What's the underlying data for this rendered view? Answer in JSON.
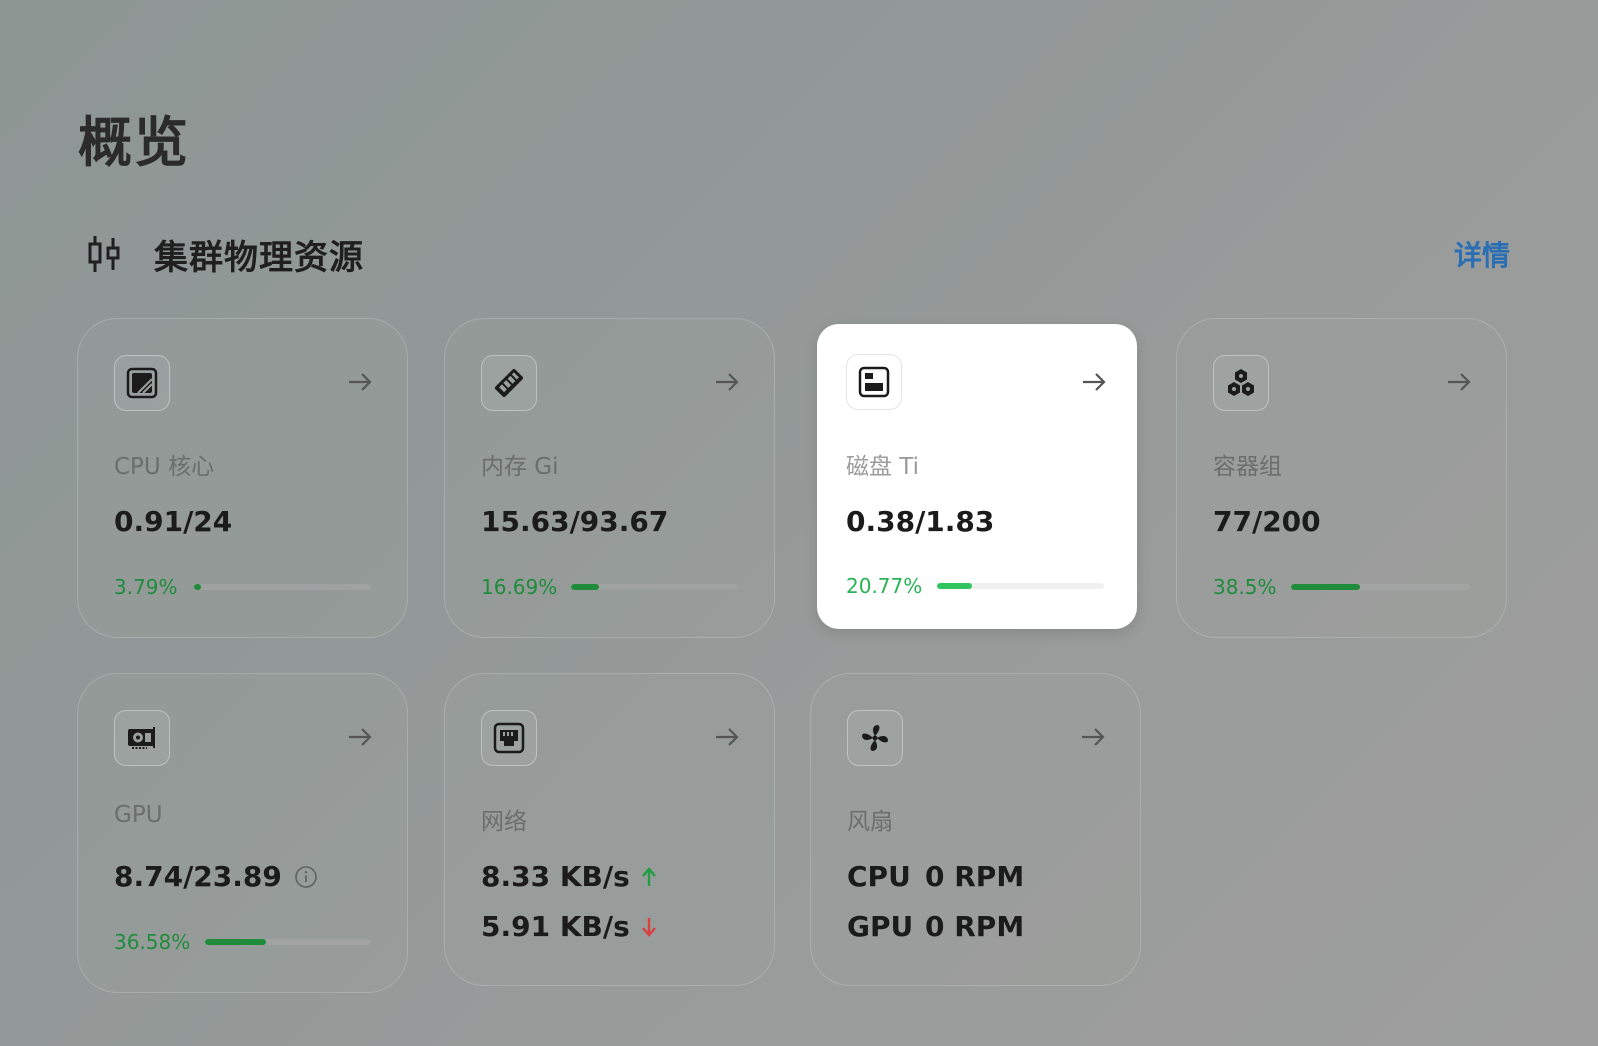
{
  "page": {
    "title": "概览"
  },
  "section": {
    "title": "集群物理资源",
    "details_label": "详情",
    "details_color": "#2a6fb3"
  },
  "cards": {
    "cpu": {
      "label": "CPU 核心",
      "value": "0.91/24",
      "percent": "3.79%",
      "progress": 0.0379,
      "icon": "cpu-chip-icon"
    },
    "memory": {
      "label": "内存 Gi",
      "value": "15.63/93.67",
      "percent": "16.69%",
      "progress": 0.1669,
      "icon": "memory-stick-icon"
    },
    "disk": {
      "label": "磁盘 Ti",
      "value": "0.38/1.83",
      "percent": "20.77%",
      "progress": 0.2077,
      "icon": "disk-drive-icon",
      "active": true
    },
    "pods": {
      "label": "容器组",
      "value": "77/200",
      "percent": "38.5%",
      "progress": 0.385,
      "icon": "hexagon-cluster-icon"
    },
    "gpu": {
      "label": "GPU",
      "value": "8.74/23.89",
      "percent": "36.58%",
      "progress": 0.3658,
      "icon": "graphics-card-icon"
    },
    "network": {
      "label": "网络",
      "upload": "8.33 KB/s",
      "download": "5.91 KB/s",
      "icon": "ethernet-port-icon"
    },
    "fan": {
      "label": "风扇",
      "cpu_key": "CPU",
      "cpu_value": "0 RPM",
      "gpu_key": "GPU",
      "gpu_value": "0 RPM",
      "icon": "fan-icon"
    }
  },
  "colors": {
    "progress": "#1f8c3c",
    "progress_active": "#2fc460",
    "upload_arrow": "#1f9e45",
    "download_arrow": "#d94040"
  }
}
